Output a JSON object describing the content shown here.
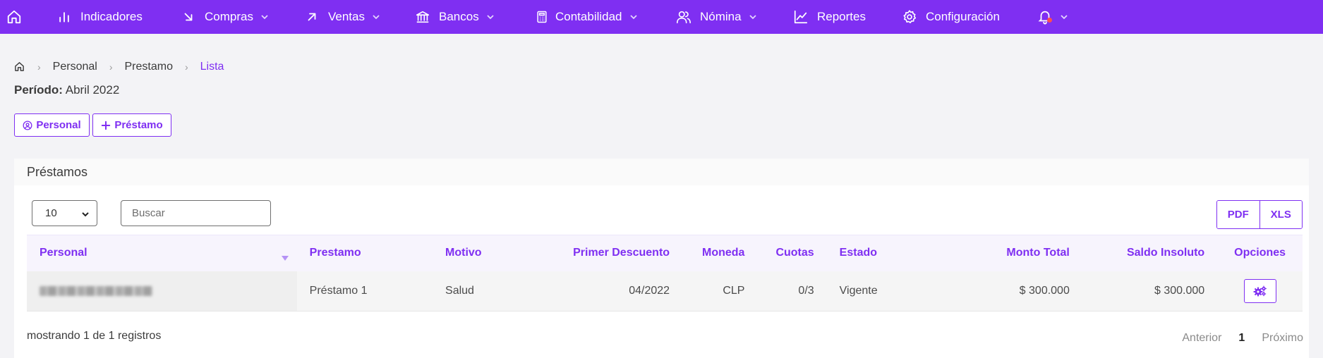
{
  "navbar": {
    "items": [
      {
        "label": "Indicadores",
        "icon": "bar-chart-icon",
        "dropdown": false
      },
      {
        "label": "Compras",
        "icon": "arrow-down-right-icon",
        "dropdown": true
      },
      {
        "label": "Ventas",
        "icon": "arrow-up-right-icon",
        "dropdown": true
      },
      {
        "label": "Bancos",
        "icon": "bank-icon",
        "dropdown": true
      },
      {
        "label": "Contabilidad",
        "icon": "calculator-icon",
        "dropdown": true
      },
      {
        "label": "Nómina",
        "icon": "users-icon",
        "dropdown": true
      },
      {
        "label": "Reportes",
        "icon": "line-chart-icon",
        "dropdown": false
      },
      {
        "label": "Configuración",
        "icon": "gear-icon",
        "dropdown": false
      }
    ],
    "accent": "#7f2ff2",
    "notification_dot": "#ff4d4f"
  },
  "breadcrumb": {
    "items": [
      "Personal",
      "Prestamo",
      "Lista"
    ]
  },
  "periodo": {
    "label": "Período:",
    "value": "Abril 2022"
  },
  "actions": {
    "personal_label": "Personal",
    "prestamo_label": "Préstamo"
  },
  "card": {
    "title": "Préstamos",
    "page_length": "10",
    "search_placeholder": "Buscar",
    "export": {
      "pdf": "PDF",
      "xls": "XLS"
    },
    "table": {
      "columns": [
        "Personal",
        "Prestamo",
        "Motivo",
        "Primer Descuento",
        "Moneda",
        "Cuotas",
        "Estado",
        "Monto Total",
        "Saldo Insoluto",
        "Opciones"
      ],
      "rows": [
        {
          "prestamo": "Préstamo 1",
          "motivo": "Salud",
          "primer_descuento": "04/2022",
          "moneda": "CLP",
          "cuotas": "0/3",
          "estado": "Vigente",
          "monto_total": "$ 300.000",
          "saldo_insoluto": "$ 300.000"
        }
      ]
    },
    "info": "mostrando 1 de 1 registros",
    "pager": {
      "prev": "Anterior",
      "current": "1",
      "next": "Próximo"
    }
  }
}
